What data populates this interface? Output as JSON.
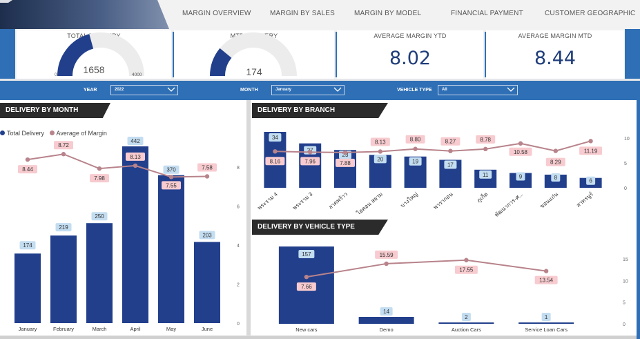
{
  "nav": {
    "items": [
      "MARGIN OVERVIEW",
      "MARGIN BY SALES",
      "MARGIN BY MODEL",
      "FINANCIAL PAYMENT",
      "CUSTOMER GEOGRAPHIC"
    ]
  },
  "kpis": {
    "total_delivery": {
      "title": "TOTAL DELIVERY",
      "value": "1658",
      "min": "0",
      "max": "4000",
      "fraction": 0.4145
    },
    "mtd_delivery": {
      "title": "MTD DELIVERY",
      "value": "174",
      "fraction": 0.22
    },
    "avg_margin_ytd": {
      "title": "AVERAGE MARGIN  YTD",
      "value": "8.02"
    },
    "avg_margin_mtd": {
      "title": "AVERAGE MARGIN  MTD",
      "value": "8.44"
    }
  },
  "filters": {
    "year": {
      "label": "YEAR",
      "value": "2022"
    },
    "month": {
      "label": "MONTH",
      "value": "January"
    },
    "vehicle_type": {
      "label": "VEHICLE TYPE",
      "value": "All"
    }
  },
  "colors": {
    "bar": "#223f8c",
    "line": "#b8838b",
    "accent": "#2f6fb5",
    "bar_label_bg": "#c3ddf1",
    "line_label_bg": "#f7cbcf"
  },
  "legend": {
    "total_delivery": "Total Delivery",
    "avg_margin": "Average of Margin"
  },
  "chart_data": [
    {
      "id": "by_month",
      "type": "bar",
      "title": "DELIVERY BY MONTH",
      "categories": [
        "January",
        "February",
        "March",
        "April",
        "May",
        "June"
      ],
      "series": [
        {
          "name": "Total Delivery",
          "type": "bar",
          "values": [
            174,
            219,
            250,
            442,
            370,
            203
          ]
        },
        {
          "name": "Average of Margin",
          "type": "line",
          "values": [
            8.44,
            8.72,
            7.98,
            8.13,
            7.55,
            7.58
          ]
        }
      ],
      "y2_ticks": [
        "0",
        "2",
        "4",
        "6",
        "8"
      ]
    },
    {
      "id": "by_branch",
      "type": "bar",
      "title": "DELIVERY BY BRANCH",
      "categories": [
        "พระราม 4",
        "พระราม 3",
        "ลาดพร้าว",
        "ไอคอน สยาม",
        "บางใหญ่",
        "พารากอน",
        "ภูเก็ต",
        "พัฒนาการ-ศ...",
        "ขอนแก่น",
        "สาทรนูร์"
      ],
      "series": [
        {
          "name": "Total Delivery",
          "type": "bar",
          "values": [
            34,
            27,
            23,
            20,
            19,
            17,
            11,
            9,
            8,
            6
          ]
        },
        {
          "name": "Average of Margin",
          "type": "line",
          "values": [
            8.16,
            7.96,
            7.88,
            8.13,
            8.8,
            8.27,
            8.78,
            10.58,
            8.29,
            11.19
          ]
        }
      ],
      "y2_ticks": [
        "0",
        "5",
        "10"
      ]
    },
    {
      "id": "by_vehicle_type",
      "type": "bar",
      "title": "DELIVERY BY VEHICLE TYPE",
      "categories": [
        "New cars",
        "Demo",
        "Auction Cars",
        "Service Loan Cars"
      ],
      "series": [
        {
          "name": "Total Delivery",
          "type": "bar",
          "values": [
            157,
            14,
            2,
            1
          ]
        },
        {
          "name": "Average of Margin",
          "type": "line",
          "values": [
            7.66,
            15.59,
            17.55,
            13.54
          ]
        }
      ],
      "y2_ticks": [
        "0",
        "5",
        "10",
        "15"
      ]
    }
  ]
}
